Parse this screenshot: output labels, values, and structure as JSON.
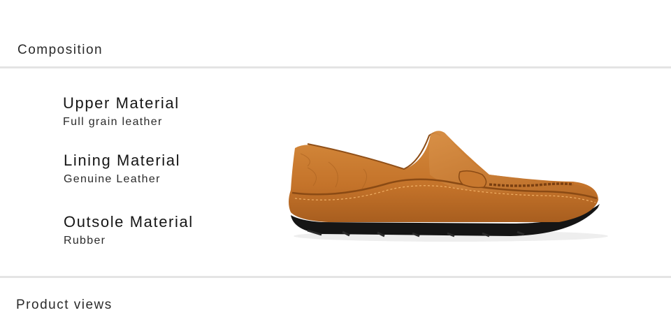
{
  "sections": {
    "composition_title": "Composition",
    "product_views_title": "Product views"
  },
  "materials": [
    {
      "name": "Upper Material",
      "value": "Full grain leather"
    },
    {
      "name": "Lining Material",
      "value": "Genuine Leather"
    },
    {
      "name": "Outsole Material",
      "value": "Rubber"
    }
  ],
  "product_image": {
    "subject": "brown leather loafer",
    "colors": {
      "leather": "#c8782e",
      "leather_dark": "#a85e1f",
      "sole": "#141414"
    }
  }
}
